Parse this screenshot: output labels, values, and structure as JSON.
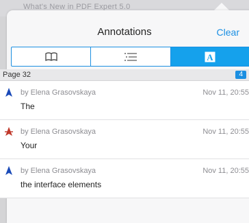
{
  "background_title": "What's New in PDF Expert 5.0",
  "header": {
    "title": "Annotations",
    "clear_label": "Clear"
  },
  "tabs": [
    {
      "name": "bookmarks",
      "icon": "open-book-icon",
      "active": false
    },
    {
      "name": "outline",
      "icon": "outline-list-icon",
      "active": false
    },
    {
      "name": "annotations",
      "icon": "annotation-letter-a-icon",
      "active": true
    }
  ],
  "section": {
    "label": "Page 32",
    "count": "4"
  },
  "annotations": [
    {
      "author": "by Elena Grasovskaya",
      "date": "Nov 11, 20:55",
      "text": "The",
      "icon": "text-pointer-icon",
      "icon_color": "#1a4ab8"
    },
    {
      "author": "by Elena Grasovskaya",
      "date": "Nov 11, 20:55",
      "text": "Your",
      "icon": "strikethrough-pointer-icon",
      "icon_color": "#c0392b"
    },
    {
      "author": "by Elena Grasovskaya",
      "date": "Nov 11, 20:55",
      "text": "the interface elements",
      "icon": "text-pointer-icon",
      "icon_color": "#1a4ab8"
    }
  ],
  "colors": {
    "accent": "#1a8fe3",
    "segment_active": "#15a1ec"
  }
}
